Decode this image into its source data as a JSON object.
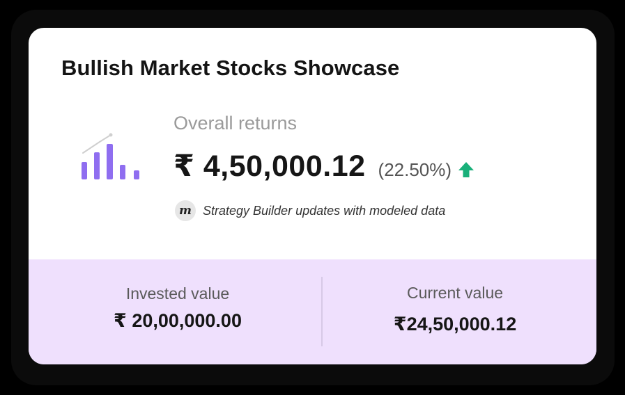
{
  "card": {
    "title": "Bullish Market Stocks Showcase"
  },
  "returns": {
    "label": "Overall returns",
    "value": "₹ 4,50,000.12",
    "percent": "(22.50%)",
    "trend_icon": "arrow-up-icon",
    "trend_color": "#19b07a"
  },
  "note": {
    "logo_letter": "m",
    "text": "Strategy Builder updates with modeled data"
  },
  "summary": {
    "invested_label": "Invested value",
    "invested_value": "₹ 20,00,000.00",
    "current_label": "Current value",
    "current_value": "₹24,50,000.12"
  },
  "colors": {
    "accent_purple": "#8f6ef0",
    "panel_background": "#efe0fd",
    "card_background": "#ffffff"
  },
  "icons": {
    "chart": "bar-chart-trend-icon"
  }
}
